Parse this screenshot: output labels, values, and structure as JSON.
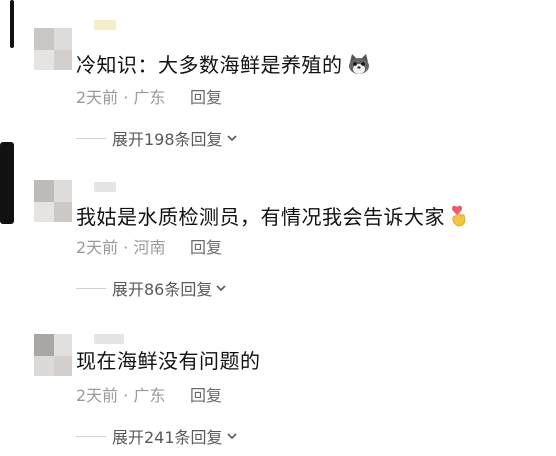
{
  "comments": [
    {
      "text": "冷知识：大多数海鲜是养殖的",
      "emoji": "dog-face-emoji",
      "time": "2天前",
      "location": "广东",
      "reply_label": "回复",
      "expand_label": "展开198条回复"
    },
    {
      "text": "我姑是水质检测员，有情况我会告诉大家",
      "emoji": "finger-heart-emoji",
      "time": "2天前",
      "location": "河南",
      "reply_label": "回复",
      "expand_label": "展开86条回复"
    },
    {
      "text": "现在海鲜没有问题的",
      "emoji": "",
      "time": "2天前",
      "location": "广东",
      "reply_label": "回复",
      "expand_label": "展开241条回复"
    }
  ],
  "meta_separator": "·"
}
